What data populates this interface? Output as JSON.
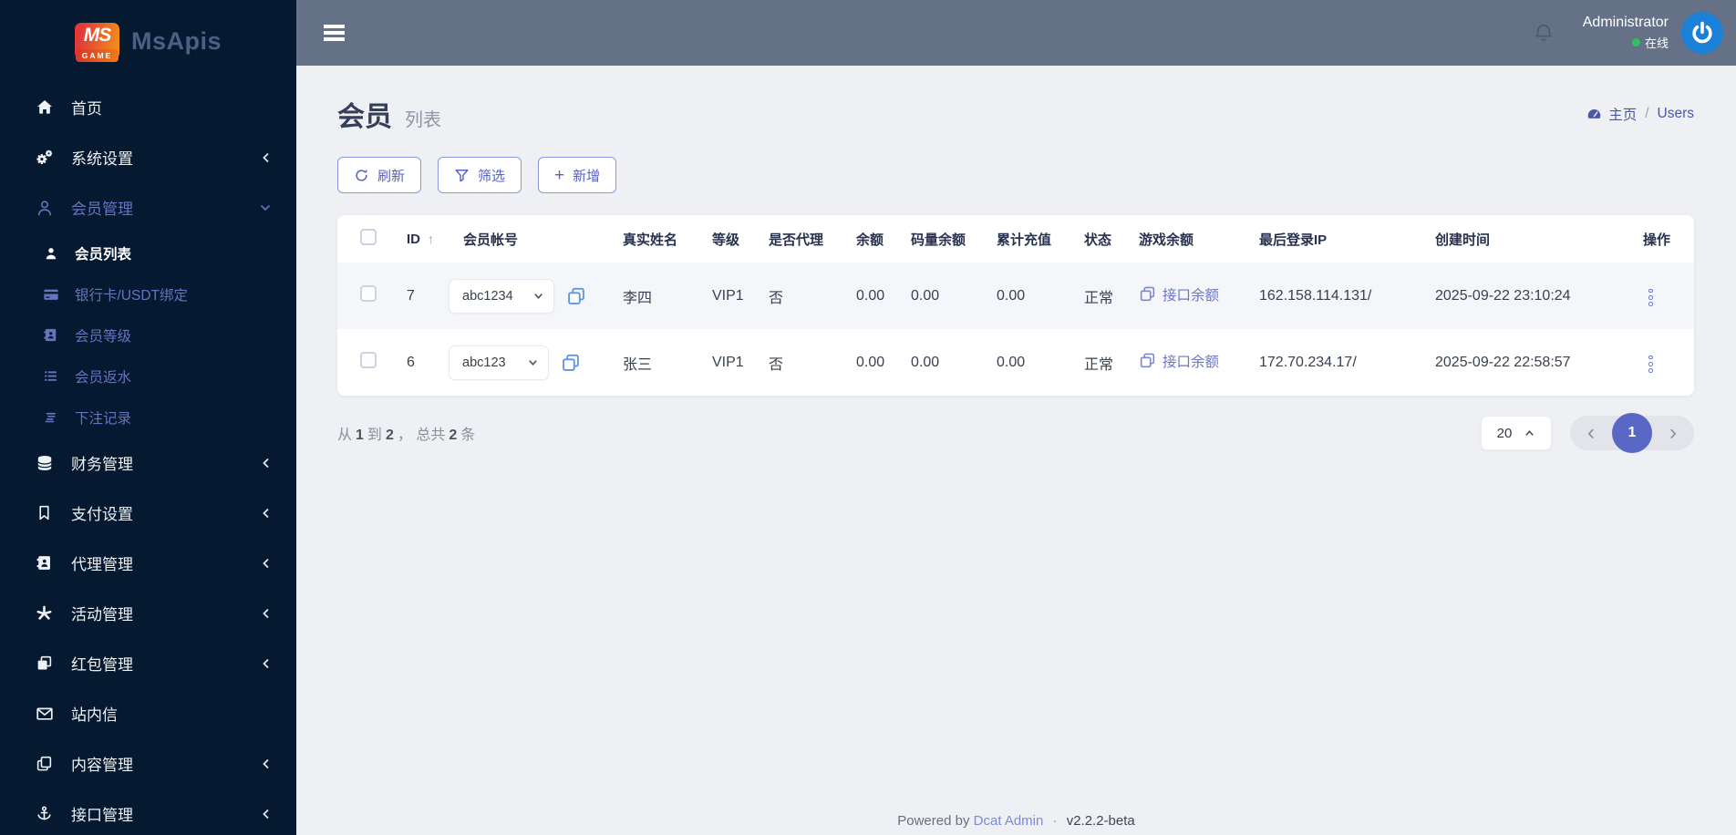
{
  "colors": {
    "sidebar_bg": "#051a30",
    "sidebar_muted": "#6474bd",
    "topbar_bg": "#657187",
    "accent": "#5462c8",
    "accent_border": "#8b97e0",
    "avatar_bg": "#1a80d8",
    "online_dot": "#2fc162",
    "page_bg": "#eef0f4",
    "pager_active": "#5968c4"
  },
  "brand": {
    "badge_top": "MS",
    "badge_bottom": "GAME",
    "app_name": "MsApis"
  },
  "topbar": {
    "username": "Administrator",
    "online_label": "在线"
  },
  "sidebar": {
    "items": [
      {
        "label": "首页"
      },
      {
        "label": "系统设置"
      },
      {
        "label": "会员管理"
      },
      {
        "label": "会员列表"
      },
      {
        "label": "银行卡/USDT绑定"
      },
      {
        "label": "会员等级"
      },
      {
        "label": "会员返水"
      },
      {
        "label": "下注记录"
      },
      {
        "label": "财务管理"
      },
      {
        "label": "支付设置"
      },
      {
        "label": "代理管理"
      },
      {
        "label": "活动管理"
      },
      {
        "label": "红包管理"
      },
      {
        "label": "站内信"
      },
      {
        "label": "内容管理"
      },
      {
        "label": "接口管理"
      }
    ]
  },
  "page": {
    "title": "会员",
    "subtitle": "列表"
  },
  "breadcrumb": {
    "home": "主页",
    "separator": "/",
    "current": "Users"
  },
  "toolbar": {
    "refresh_label": "刷新",
    "filter_label": "筛选",
    "add_plus": "+",
    "add_label": "新增"
  },
  "table": {
    "headers": {
      "id": "ID",
      "account": "会员帐号",
      "real_name": "真实姓名",
      "level": "等级",
      "is_agent": "是否代理",
      "balance": "余额",
      "code_balance": "码量余额",
      "total_deposit": "累计充值",
      "status": "状态",
      "game_balance": "游戏余额",
      "last_login_ip": "最后登录IP",
      "created_at": "创建时间",
      "actions": "操作"
    },
    "sort_arrow": "↑",
    "rows": [
      {
        "id": "7",
        "account": "abc1234",
        "real_name": "李四",
        "level": "VIP1",
        "is_agent": "否",
        "balance": "0.00",
        "code_balance": "0.00",
        "total_deposit": "0.00",
        "status": "正常",
        "game_balance_label": "接口余额",
        "last_login_ip": "162.158.114.131/",
        "created_at": "2025-09-22 23:10:24"
      },
      {
        "id": "6",
        "account": "abc123",
        "real_name": "张三",
        "level": "VIP1",
        "is_agent": "否",
        "balance": "0.00",
        "code_balance": "0.00",
        "total_deposit": "0.00",
        "status": "正常",
        "game_balance_label": "接口余额",
        "last_login_ip": "172.70.234.17/",
        "created_at": "2025-09-22 22:58:57"
      }
    ]
  },
  "pagination": {
    "info": {
      "from_label": "从",
      "from_value": "1",
      "to_label": "到",
      "to_value": "2",
      "comma": "，",
      "total_label": "总共",
      "total_value": "2",
      "unit": "条"
    },
    "page_size": "20",
    "current_page": "1",
    "prev": "‹",
    "next": "›"
  },
  "footer": {
    "powered_by": "Powered by",
    "brand_link": "Dcat Admin",
    "separator": "·",
    "version": "v2.2.2-beta"
  }
}
